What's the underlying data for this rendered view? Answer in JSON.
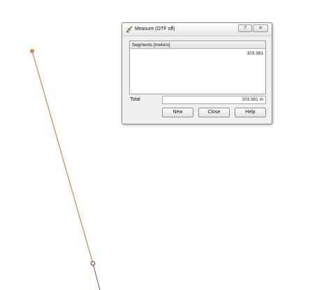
{
  "dialog": {
    "title": "Measure (OTF off)",
    "title_help_glyph": "?",
    "title_close_glyph": "✕",
    "segments_header": "Segments [meters]",
    "segments": [
      "103.381"
    ],
    "total_label": "Total",
    "total_value": "103.381 m",
    "buttons": {
      "new": "New",
      "close": "Close",
      "help": "Help"
    }
  },
  "map": {
    "measure_line_color": "#c8915d",
    "vertex_start_color": "#d08a55",
    "vertex_end_color": "#a0506a",
    "feature_line_color": "#6a5acd"
  }
}
